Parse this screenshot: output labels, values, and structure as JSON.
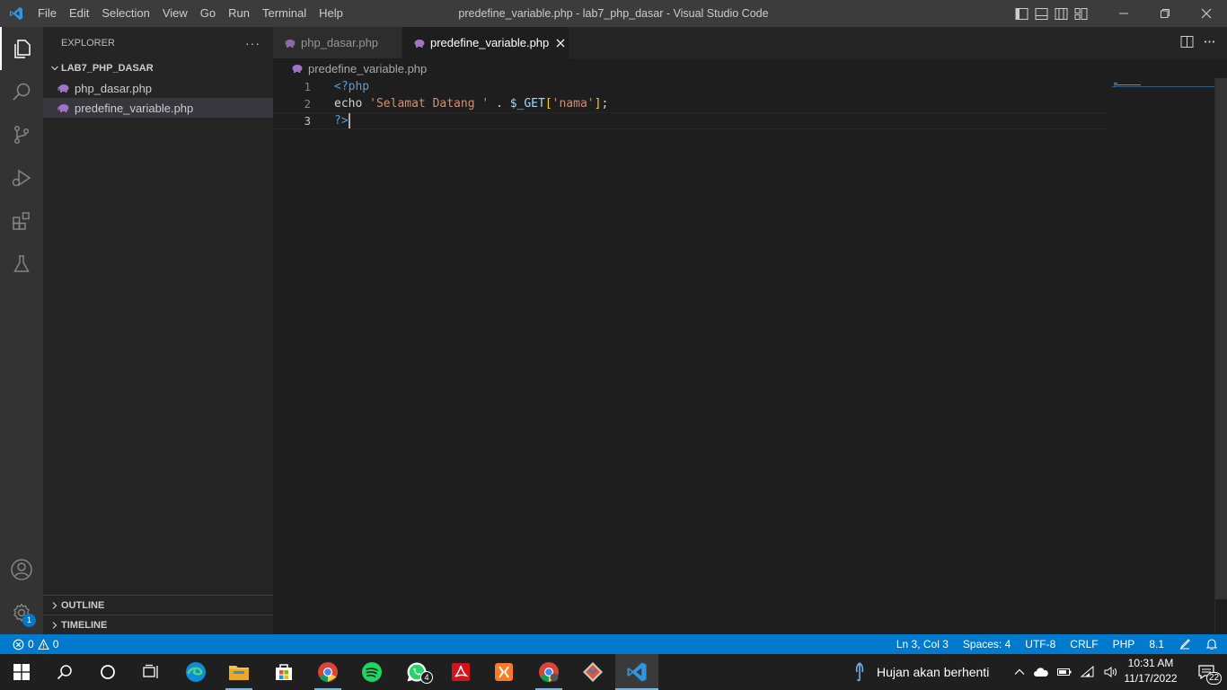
{
  "app": {
    "window_title": "predefine_variable.php - lab7_php_dasar - Visual Studio Code",
    "menu": [
      "File",
      "Edit",
      "Selection",
      "View",
      "Go",
      "Run",
      "Terminal",
      "Help"
    ]
  },
  "activity_bar": {
    "items": [
      "explorer",
      "search",
      "source-control",
      "run-and-debug",
      "extensions",
      "testing"
    ],
    "bottom": [
      "accounts",
      "manage"
    ],
    "manage_badge": "1"
  },
  "sidebar": {
    "title": "EXPLORER",
    "more": "···",
    "folder": "LAB7_PHP_DASAR",
    "files": [
      "php_dasar.php",
      "predefine_variable.php"
    ],
    "selected_file": "predefine_variable.php",
    "sections": [
      "OUTLINE",
      "TIMELINE"
    ]
  },
  "editor": {
    "tabs": [
      {
        "label": "php_dasar.php",
        "active": false
      },
      {
        "label": "predefine_variable.php",
        "active": true
      }
    ],
    "breadcrumb": "predefine_variable.php",
    "lines": [
      {
        "number": "1",
        "text": "<?php"
      },
      {
        "number": "2",
        "text": "echo 'Selamat Datang ' . $_GET['nama'];"
      },
      {
        "number": "3",
        "text": "?>"
      }
    ],
    "tokens": {
      "open_tag": "<?php",
      "echo": "echo ",
      "string": "'Selamat Datang '",
      "dot": " . ",
      "var": "$_GET",
      "lbr": "[",
      "key": "'nama'",
      "rbr": "]",
      "semi": ";",
      "close_q": "?",
      "close_gt": ">"
    }
  },
  "status_bar": {
    "errors": "0",
    "warnings": "0",
    "position": "Ln 3, Col 3",
    "spaces": "Spaces: 4",
    "encoding": "UTF-8",
    "eol": "CRLF",
    "language": "PHP",
    "php_version": "8.1"
  },
  "taskbar": {
    "apps": [
      "start",
      "search",
      "cortana",
      "task-view",
      "edge",
      "file-explorer",
      "store",
      "chrome",
      "spotify",
      "whatsapp",
      "acrobat",
      "xampp",
      "chrome-profile",
      "git",
      "vscode"
    ],
    "whatsapp_badge": "4",
    "weather_text": "Hujan akan berhenti",
    "time": "10:31 AM",
    "date": "11/17/2022",
    "notification_count": "22"
  },
  "colors": {
    "accent": "#007acc",
    "titlebar": "#3c3c3c",
    "activitybar": "#333333",
    "sidebar": "#252526",
    "editor": "#1e1e1e"
  }
}
